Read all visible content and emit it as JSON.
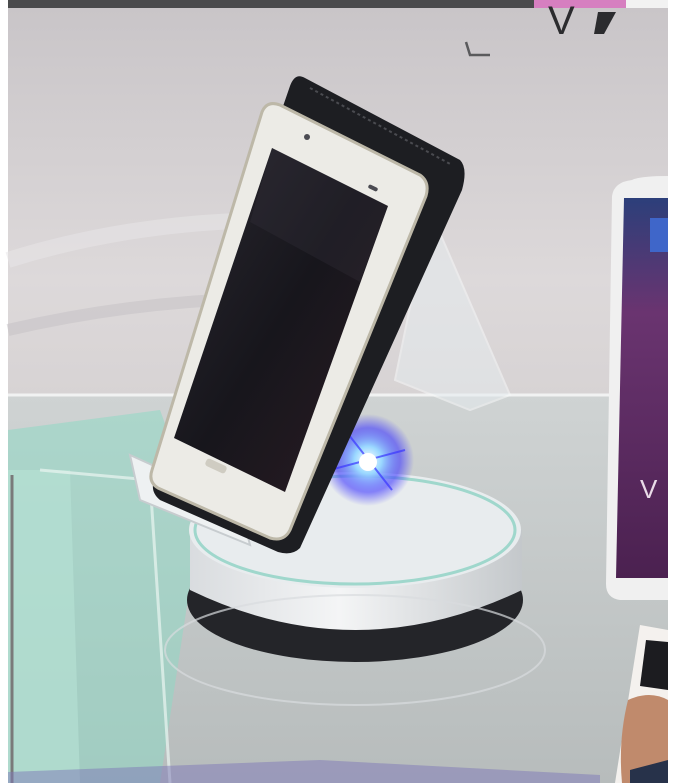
{
  "photo": {
    "subject": "smartphone-on-rotating-display-stand",
    "background_sign_text": "V",
    "right_phone_screen_text": "V",
    "colors": {
      "frame_border": "#ffffff",
      "top_bar_dark": "#4a4a4c",
      "top_bar_pink": "#d67fc0",
      "wall": "#d8d4d6",
      "phone_body": "#ecebe6",
      "phone_screen": "#1c1b22",
      "phone_case": "#1d1e22",
      "stand_base": "#e3e6e8",
      "stand_rim": "#2a2b2f",
      "glass_teal": "#8fd8c4",
      "led_blue": "#3a36ff",
      "right_phone_screen": "#5e2a62"
    }
  }
}
